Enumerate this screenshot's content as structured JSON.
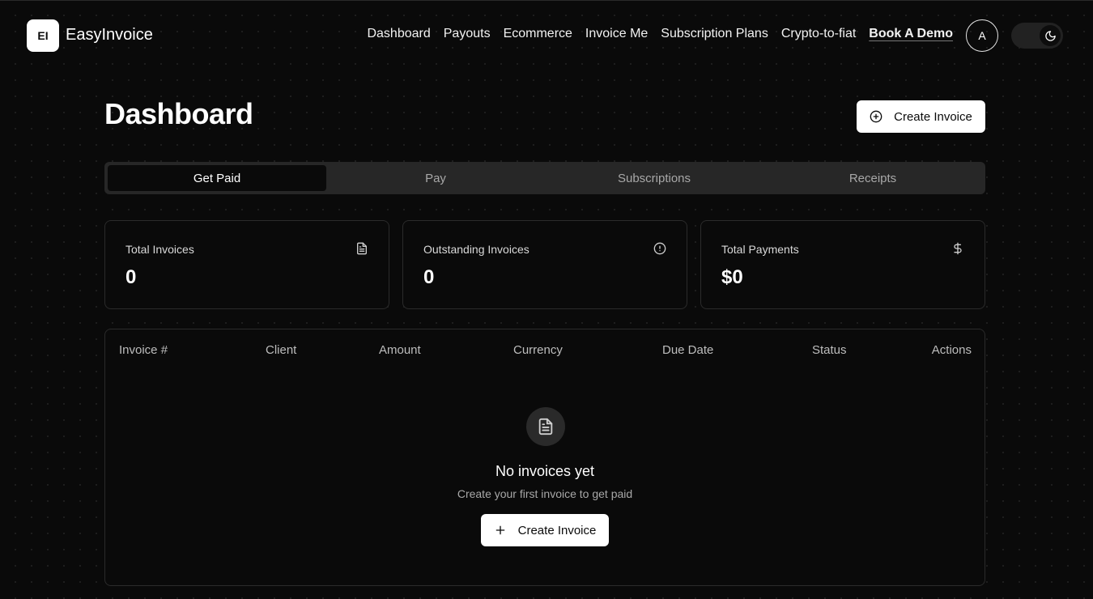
{
  "brand": {
    "logo_text": "EI",
    "name": "EasyInvoice"
  },
  "nav": {
    "items": [
      "Dashboard",
      "Payouts",
      "Ecommerce",
      "Invoice Me",
      "Subscription Plans",
      "Crypto-to-fiat"
    ],
    "demo_label": "Book A Demo"
  },
  "user": {
    "avatar_initial": "A"
  },
  "theme_toggle": {
    "icon": "moon-icon",
    "mode": "dark"
  },
  "page": {
    "title": "Dashboard",
    "create_button": "Create Invoice",
    "create_icon": "plus-circle-icon"
  },
  "tabs": [
    {
      "label": "Get Paid",
      "active": true
    },
    {
      "label": "Pay",
      "active": false
    },
    {
      "label": "Subscriptions",
      "active": false
    },
    {
      "label": "Receipts",
      "active": false
    }
  ],
  "stats": [
    {
      "label": "Total Invoices",
      "value": "0",
      "icon": "file-text-icon"
    },
    {
      "label": "Outstanding Invoices",
      "value": "0",
      "icon": "alert-circle-icon"
    },
    {
      "label": "Total Payments",
      "value": "$0",
      "icon": "dollar-sign-icon"
    }
  ],
  "table": {
    "columns": [
      "Invoice #",
      "Client",
      "Amount",
      "Currency",
      "Due Date",
      "Status",
      "Actions"
    ],
    "rows": [],
    "empty": {
      "icon": "file-text-icon",
      "title": "No invoices yet",
      "subtitle": "Create your first invoice to get paid",
      "button": "Create Invoice",
      "button_icon": "plus-icon"
    }
  },
  "colors": {
    "background": "#0a0a0a",
    "surface": "#272727",
    "border": "#2b2b2b",
    "text": "#ffffff",
    "muted": "#a8a8a8"
  }
}
